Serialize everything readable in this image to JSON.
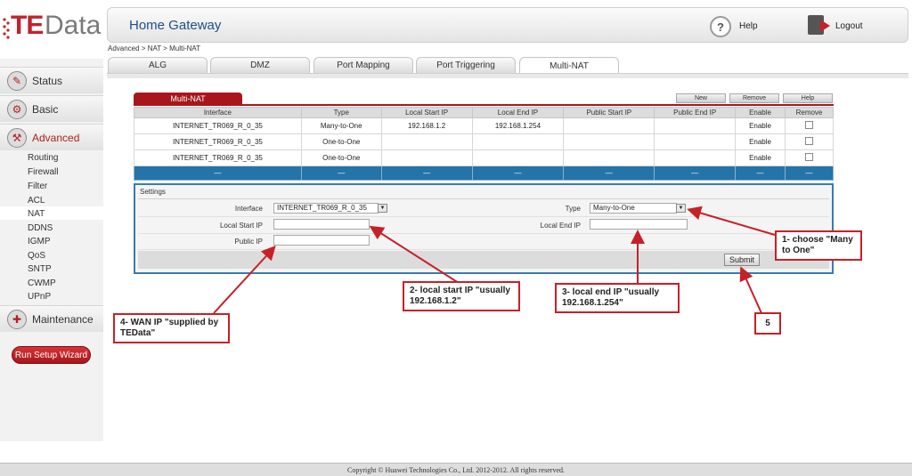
{
  "brand": {
    "logo_te": "TE",
    "logo_data": "Data"
  },
  "header": {
    "title": "Home Gateway",
    "help": "Help",
    "logout": "Logout"
  },
  "breadcrumb": "Advanced > NAT > Multi-NAT",
  "tabs": [
    "ALG",
    "DMZ",
    "Port Mapping",
    "Port Triggering",
    "Multi-NAT"
  ],
  "active_tab": "Multi-NAT",
  "sidebar": {
    "main": [
      "Status",
      "Basic",
      "Advanced",
      "Maintenance"
    ],
    "sub": [
      "Routing",
      "Firewall",
      "Filter",
      "ACL",
      "NAT",
      "DDNS",
      "IGMP",
      "QoS",
      "SNTP",
      "CWMP",
      "UPnP"
    ],
    "active_sub": "NAT",
    "wizard": "Run Setup Wizard"
  },
  "panel": {
    "title": "Multi-NAT",
    "buttons": {
      "new": "New",
      "remove": "Remove",
      "help": "Help"
    },
    "columns": [
      "Interface",
      "Type",
      "Local Start IP",
      "Local End IP",
      "Public Start IP",
      "Public End IP",
      "Enable",
      "Remove"
    ],
    "rows": [
      {
        "interface": "INTERNET_TR069_R_0_35",
        "type": "Many-to-One",
        "local_start": "192.168.1.2",
        "local_end": "192.168.1.254",
        "public_start": "",
        "public_end": "",
        "enable": "Enable"
      },
      {
        "interface": "INTERNET_TR069_R_0_35",
        "type": "One-to-One",
        "local_start": "",
        "local_end": "",
        "public_start": "",
        "public_end": "",
        "enable": "Enable"
      },
      {
        "interface": "INTERNET_TR069_R_0_35",
        "type": "One-to-One",
        "local_start": "",
        "local_end": "",
        "public_start": "",
        "public_end": "",
        "enable": "Enable"
      }
    ],
    "band_text": "—"
  },
  "settings": {
    "title": "Settings",
    "interface_label": "Interface",
    "interface_value": "INTERNET_TR069_R_0_35",
    "type_label": "Type",
    "type_value": "Many-to-One",
    "local_start_label": "Local Start IP",
    "local_start_value": "",
    "local_end_label": "Local End IP",
    "local_end_value": "",
    "public_ip_label": "Public IP",
    "public_ip_value": "",
    "submit": "Submit"
  },
  "callouts": {
    "c1": "1- choose \"Many to One\"",
    "c2": "2- local start IP \"usually 192.168.1.2\"",
    "c3": "3- local end IP \"usually 192.168.1.254\"",
    "c4": "4- WAN IP \"supplied by TEData\"",
    "c5": "5"
  },
  "colors": {
    "brand_red": "#c0232c",
    "accent_blue": "#2574a9",
    "annotation_red": "#c62127"
  },
  "footer": "Copyright © Huawei Technologies Co., Ltd. 2012-2012. All rights reserved."
}
